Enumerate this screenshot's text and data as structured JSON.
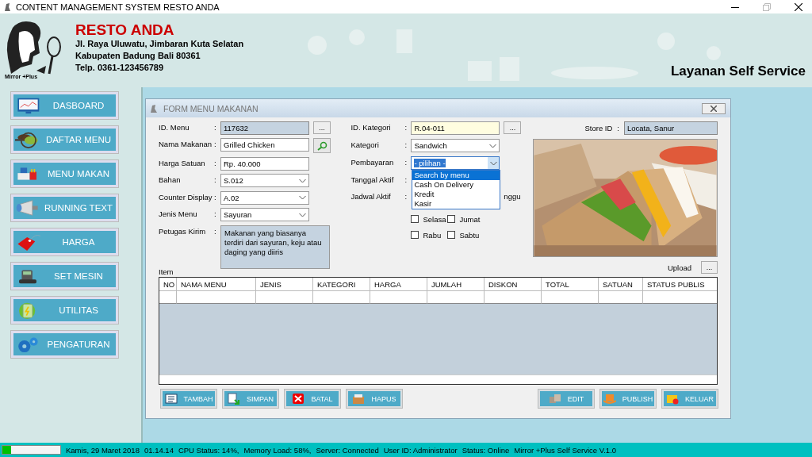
{
  "window": {
    "title": "CONTENT MANAGEMENT SYSTEM RESTO ANDA"
  },
  "header": {
    "logo_caption": "Mirror +Plus",
    "name": "RESTO ANDA",
    "address": [
      "Jl. Raya Uluwatu, Jimbaran Kuta Selatan",
      "Kabupaten Badung Bali 80361",
      "Telp. 0361-123456789"
    ],
    "service": "Layanan Self Service"
  },
  "sidebar": {
    "items": [
      {
        "label": "DASBOARD",
        "kind": "monitor"
      },
      {
        "label": "DAFTAR MENU",
        "kind": "leaves"
      },
      {
        "label": "MENU MAKAN",
        "kind": "food"
      },
      {
        "label": "RUNNING TEXT",
        "kind": "megaphone"
      },
      {
        "label": "HARGA",
        "kind": "tag"
      },
      {
        "label": "SET MESIN",
        "kind": "terminal"
      },
      {
        "label": "UTILITAS",
        "kind": "battery"
      },
      {
        "label": "PENGATURAN",
        "kind": "gears"
      }
    ]
  },
  "form": {
    "title": "FORM MENU MAKANAN",
    "left_fields": [
      {
        "label": "ID. Menu",
        "colon": ":",
        "kind": "readonly",
        "value": "117632",
        "button": "..."
      },
      {
        "label": "Nama Makanan",
        "colon": ":",
        "kind": "search",
        "value": "Grilled Chicken"
      },
      {
        "label": "Harga Satuan",
        "colon": ":",
        "kind": "text",
        "value": "Rp. 40.000"
      },
      {
        "label": "Bahan",
        "colon": ":",
        "kind": "combo",
        "value": "S.012"
      },
      {
        "label": "Counter Display",
        "colon": ":",
        "kind": "combo",
        "value": "A.02"
      },
      {
        "label": "Jenis Menu",
        "colon": ":",
        "kind": "combo",
        "value": "Sayuran"
      },
      {
        "label": "Petugas Kirim",
        "colon": ":",
        "kind": "memo",
        "value": "Makanan yang biasanya terdiri dari sayuran, keju atau daging yang diiris"
      }
    ],
    "right_fields": [
      {
        "label": "ID. Kategori",
        "colon": ":",
        "kind": "highlighted",
        "value": "R.04-011",
        "button": "..."
      },
      {
        "label": "Kategori",
        "colon": ":",
        "kind": "combo",
        "value": "Sandwich"
      },
      {
        "label": "Pembayaran",
        "colon": ":",
        "kind": "dropdown",
        "value": "- pilihan -",
        "expanded": true,
        "options": [
          {
            "label": "Search by menu",
            "selected": true
          },
          {
            "label": "Cash On Delivery",
            "selected": false
          },
          {
            "label": "Kredit",
            "selected": false
          },
          {
            "label": "Kasir",
            "selected": false
          }
        ]
      },
      {
        "label": "Tanggal Aktif",
        "colon": ":",
        "kind": "hidden"
      },
      {
        "label": "Jadwal Aktif",
        "colon": ":",
        "kind": "days",
        "days": [
          {
            "label": "nggu",
            "kind": "partial"
          },
          {
            "label": "Selasa",
            "kind": "checkbox",
            "checked": false
          },
          {
            "label": "Jumat",
            "kind": "checkbox",
            "checked": false
          },
          {
            "label": "Rabu",
            "kind": "checkbox",
            "checked": false
          },
          {
            "label": "Sabtu",
            "kind": "checkbox",
            "checked": false
          }
        ]
      }
    ],
    "store": {
      "label": "Store ID",
      "colon": ":",
      "value": "Locata, Sanur"
    },
    "upload": {
      "label": "Upload",
      "button": "..."
    },
    "table": {
      "caption": "Item",
      "columns": [
        "NO",
        "NAMA MENU",
        "JENIS",
        "KATEGORI",
        "HARGA",
        "JUMLAH",
        "DISKON",
        "TOTAL",
        "SATUAN",
        "STATUS PUBLIS"
      ]
    },
    "left_buttons": [
      {
        "label": "TAMBAH",
        "kind": "add"
      },
      {
        "label": "SIMPAN",
        "kind": "save"
      },
      {
        "label": "BATAL",
        "kind": "cancel"
      },
      {
        "label": "HAPUS",
        "kind": "delete"
      }
    ],
    "right_buttons": [
      {
        "label": "EDIT",
        "kind": "edit"
      },
      {
        "label": "PUBLISH",
        "kind": "publish"
      },
      {
        "label": "KELUAR",
        "kind": "exit"
      }
    ]
  },
  "status_bar": {
    "level": 0.15,
    "items": [
      "Kamis, 29 Maret 2018",
      "01.14.14",
      "CPU Status: 14%,",
      "Memory Load: 58%,",
      "Server: Connected",
      "User ID: Administrator",
      "Status: Online",
      "Mirror +Plus Self Service V.1.0"
    ]
  }
}
